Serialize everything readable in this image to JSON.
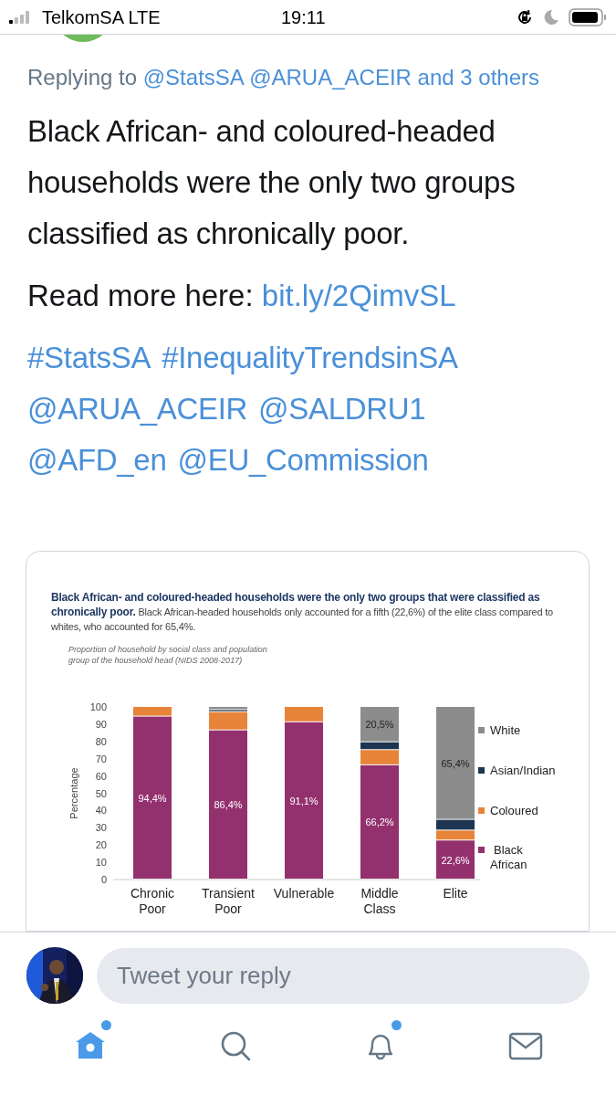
{
  "status_bar": {
    "carrier": "TelkomSA LTE",
    "time": "19:11"
  },
  "tweet": {
    "replying_prefix": "Replying to",
    "replying_to": "@StatsSA @ARUA_ACEIR and 3 others",
    "text": "Black African- and coloured-headed households were the only two groups classified as chronically poor.",
    "read_more_label": "Read more here:",
    "link": "bit.ly/2QimvSL",
    "tags": [
      "#StatsSA",
      "#InequalityTrendsinSA",
      "@ARUA_ACEIR",
      "@SALDRU1",
      "@AFD_en",
      "@EU_Commission"
    ],
    "image": {
      "heading": "**Black African- and coloured-headed households were the only two groups that were classified as chronically  poor.** Black African-headed households only accounted for a fifth (22,6%) of the elite class compared to whites, who accounted for 65,4%.",
      "note": "Proportion of household by social class and population group of the household head (NIDS 2008-2017)",
      "chart_data": {
        "type": "bar",
        "stacked": true,
        "orientation": "vertical",
        "ylabel": "Percentage",
        "categories": [
          "Chronic Poor",
          "Transient Poor",
          "Vulnerable",
          "Middle Class",
          "Elite"
        ],
        "ylim": [
          0,
          100
        ],
        "yticks": [
          0,
          10,
          20,
          30,
          40,
          50,
          60,
          70,
          80,
          90,
          100
        ],
        "series": [
          {
            "name": "Black African",
            "color": "#93306e",
            "values": [
              94.4,
              86.4,
              91.1,
              66.2,
              22.6
            ]
          },
          {
            "name": "Coloured",
            "color": "#e8843a",
            "values": [
              5.6,
              10.6,
              8.9,
              8.8,
              5.8
            ]
          },
          {
            "name": "Asian/Indian",
            "color": "#1d3551",
            "values": [
              0,
              1.2,
              0,
              4.5,
              6.2
            ]
          },
          {
            "name": "White",
            "color": "#8c8c8c",
            "values": [
              0,
              1.8,
              0,
              20.5,
              65.4
            ]
          }
        ],
        "value_labels": [
          [
            "94,4%",
            "86,4%",
            "91,1%",
            "66,2%",
            "22,6%"
          ],
          [
            null,
            null,
            null,
            null,
            null
          ],
          [
            null,
            null,
            null,
            null,
            null
          ],
          [
            null,
            null,
            null,
            "20,5%",
            "65,4%"
          ]
        ],
        "legend": "right"
      }
    }
  },
  "reply": {
    "placeholder": "Tweet your reply"
  },
  "tabs": [
    {
      "kind": "home",
      "selected": true,
      "dot": true
    },
    {
      "kind": "search",
      "selected": false,
      "dot": false
    },
    {
      "kind": "notifications",
      "selected": false,
      "dot": true
    },
    {
      "kind": "messages",
      "selected": false,
      "dot": false
    }
  ]
}
